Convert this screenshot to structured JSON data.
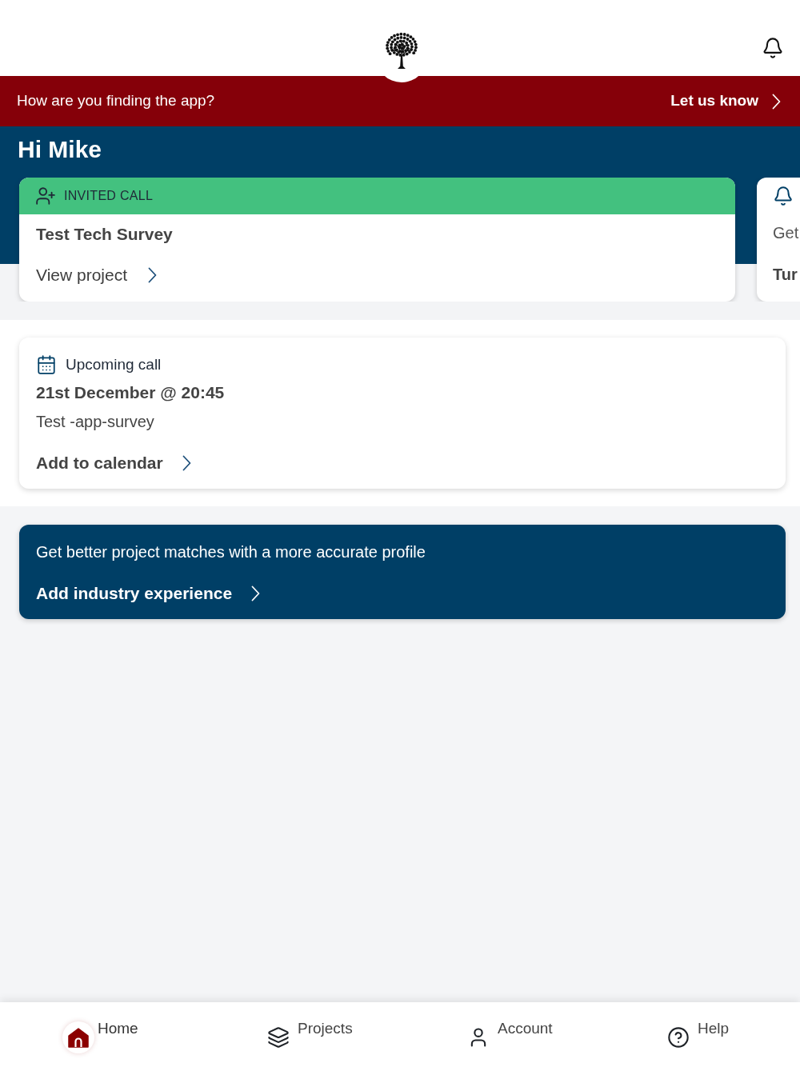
{
  "feedback_banner": {
    "question": "How are you finding the app?",
    "link": "Let us know"
  },
  "greeting": "Hi Mike",
  "cards": [
    {
      "kind": "invited_call",
      "tag": "INVITED CALL",
      "title": "Test Tech Survey",
      "link": "View project"
    },
    {
      "kind": "notice",
      "title": "Get",
      "link": "Tur"
    }
  ],
  "upcoming_call": {
    "label": "Upcoming call",
    "date": "21st December @ 20:45",
    "project": "Test -app-survey",
    "link": "Add to calendar"
  },
  "profile_prompt": {
    "text": "Get better project matches with a more accurate profile",
    "link": "Add industry experience"
  },
  "tab_bar": [
    {
      "label": "Home",
      "selected": true
    },
    {
      "label": "Projects",
      "selected": false
    },
    {
      "label": "Account",
      "selected": false
    },
    {
      "label": "Help",
      "selected": false
    }
  ]
}
